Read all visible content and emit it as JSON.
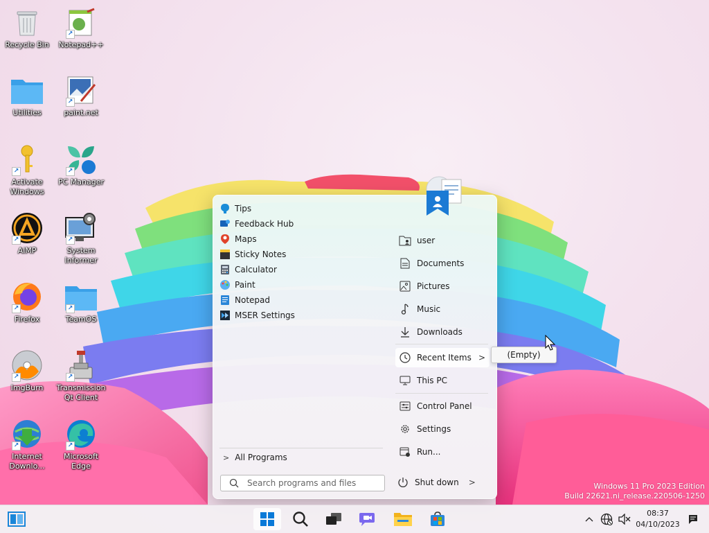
{
  "desktop": {
    "icons": [
      {
        "label": "Recycle Bin"
      },
      {
        "label": "Notepad++"
      },
      {
        "label": "Utilities"
      },
      {
        "label": "paint.net"
      },
      {
        "label": "Activate Windows"
      },
      {
        "label": "PC Manager"
      },
      {
        "label": "AIMP"
      },
      {
        "label": "System Informer"
      },
      {
        "label": "Firefox"
      },
      {
        "label": "TeamOS"
      },
      {
        "label": "ImgBurn"
      },
      {
        "label": "Transmission Qt Client"
      },
      {
        "label": "Internet Downlo..."
      },
      {
        "label": "Microsoft Edge"
      }
    ]
  },
  "start_menu": {
    "programs": [
      {
        "label": "Tips",
        "icon": "tips-icon"
      },
      {
        "label": "Feedback Hub",
        "icon": "feedback-hub-icon"
      },
      {
        "label": "Maps",
        "icon": "maps-icon"
      },
      {
        "label": "Sticky Notes",
        "icon": "sticky-notes-icon"
      },
      {
        "label": "Calculator",
        "icon": "calculator-icon"
      },
      {
        "label": "Paint",
        "icon": "paint-icon"
      },
      {
        "label": "Notepad",
        "icon": "notepad-icon"
      },
      {
        "label": "MSER Settings",
        "icon": "mser-settings-icon"
      }
    ],
    "all_programs": "All Programs",
    "search_placeholder": "Search programs and files",
    "right_items": [
      {
        "label": "user",
        "icon": "user-folder-icon"
      },
      {
        "label": "Documents",
        "icon": "documents-icon"
      },
      {
        "label": "Pictures",
        "icon": "pictures-icon"
      },
      {
        "label": "Music",
        "icon": "music-icon"
      },
      {
        "label": "Downloads",
        "icon": "downloads-icon"
      },
      {
        "label": "Recent Items",
        "icon": "clock-icon"
      },
      {
        "label": "This PC",
        "icon": "computer-icon"
      },
      {
        "label": "Control Panel",
        "icon": "control-panel-icon"
      },
      {
        "label": "Settings",
        "icon": "gear-icon"
      },
      {
        "label": "Run...",
        "icon": "run-icon"
      }
    ],
    "shutdown": "Shut down",
    "recent_flyout": "(Empty)"
  },
  "watermark": {
    "line1": "Windows 11 Pro 2023 Edition",
    "line2": "Build 22621.ni_release.220506-1250"
  },
  "taskbar": {
    "time": "08:37",
    "date": "04/10/2023"
  },
  "colors": {
    "accent": "#0067c0",
    "menu_bg": "#f3f3f5"
  }
}
